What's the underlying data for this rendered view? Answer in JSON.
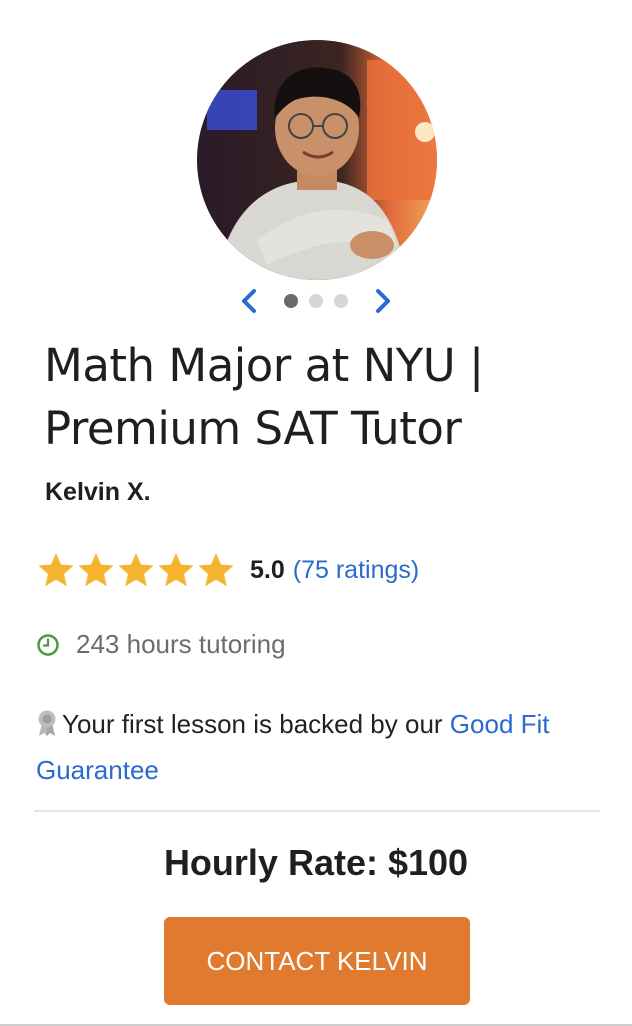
{
  "profile": {
    "avatar_alt": "Kelvin X.",
    "headline": "Math Major at NYU | Premium SAT Tutor",
    "name": "Kelvin X."
  },
  "carousel": {
    "prev_icon": "chevron-left-icon",
    "next_icon": "chevron-right-icon",
    "dots": 3,
    "active_dot": 0
  },
  "rating": {
    "stars": 5,
    "score": "5.0",
    "ratings_link": "(75 ratings)"
  },
  "stats": {
    "hours": "243 hours tutoring",
    "clock_icon": "clock-icon"
  },
  "guarantee": {
    "text": "Your first lesson is backed by our ",
    "link": "Good Fit Guarantee",
    "icon": "award-badge-icon"
  },
  "pricing": {
    "rate": "Hourly Rate: $100"
  },
  "cta": {
    "label": "CONTACT KELVIN"
  },
  "colors": {
    "accent_orange": "#e07a2f",
    "link_blue": "#2a6bcf",
    "star_gold": "#f5b52e",
    "clock_green": "#4a9a3e"
  }
}
